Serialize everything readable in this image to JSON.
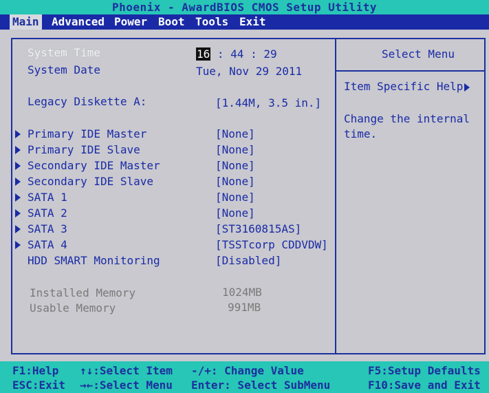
{
  "title": "Phoenix - AwardBIOS CMOS Setup Utility",
  "menu": [
    {
      "label": "Main",
      "active": true
    },
    {
      "label": "Advanced",
      "active": false
    },
    {
      "label": "Power",
      "active": false
    },
    {
      "label": "Boot",
      "active": false
    },
    {
      "label": "Tools",
      "active": false
    },
    {
      "label": "Exit",
      "active": false
    }
  ],
  "main": {
    "system_time": {
      "label": "System Time",
      "hour": "16",
      "minute": "44",
      "second": "29"
    },
    "system_date": {
      "label": "System Date",
      "value": "Tue, Nov 29 2011"
    },
    "legacy_diskette": {
      "label": "Legacy Diskette A:",
      "value": "[1.44M, 3.5 in.]"
    },
    "items": [
      {
        "label": "Primary IDE Master",
        "value": "[None]",
        "submenu": true
      },
      {
        "label": "Primary IDE Slave",
        "value": "[None]",
        "submenu": true
      },
      {
        "label": "Secondary IDE Master",
        "value": "[None]",
        "submenu": true
      },
      {
        "label": "Secondary IDE Slave",
        "value": "[None]",
        "submenu": true
      },
      {
        "label": "SATA 1",
        "value": "[None]",
        "submenu": true
      },
      {
        "label": "SATA 2",
        "value": "[None]",
        "submenu": true
      },
      {
        "label": "SATA 3",
        "value": "[ST3160815AS]",
        "submenu": true
      },
      {
        "label": "SATA 4",
        "value": "[TSSTcorp CDDVDW]",
        "submenu": true
      },
      {
        "label": "HDD SMART Monitoring",
        "value": "[Disabled]",
        "submenu": false
      }
    ],
    "installed_memory": {
      "label": "Installed Memory",
      "value": "1024MB"
    },
    "usable_memory": {
      "label": "Usable Memory",
      "value": "991MB"
    }
  },
  "help": {
    "title": "Select Menu",
    "specific": "Item Specific Help",
    "text": "Change the internal time."
  },
  "footer": {
    "f1": "F1:Help",
    "esc": "ESC:Exit",
    "select_item": "↑↓:Select Item",
    "select_menu": "→←:Select Menu",
    "change_value": "-/+: Change Value",
    "enter": "Enter: Select SubMenu",
    "f5": "F5:Setup Defaults",
    "f10": "F10:Save and Exit"
  },
  "colors": {
    "background": "#c9c9cf",
    "accent_blue": "#1a2aa6",
    "status_teal": "#27c6b6"
  }
}
